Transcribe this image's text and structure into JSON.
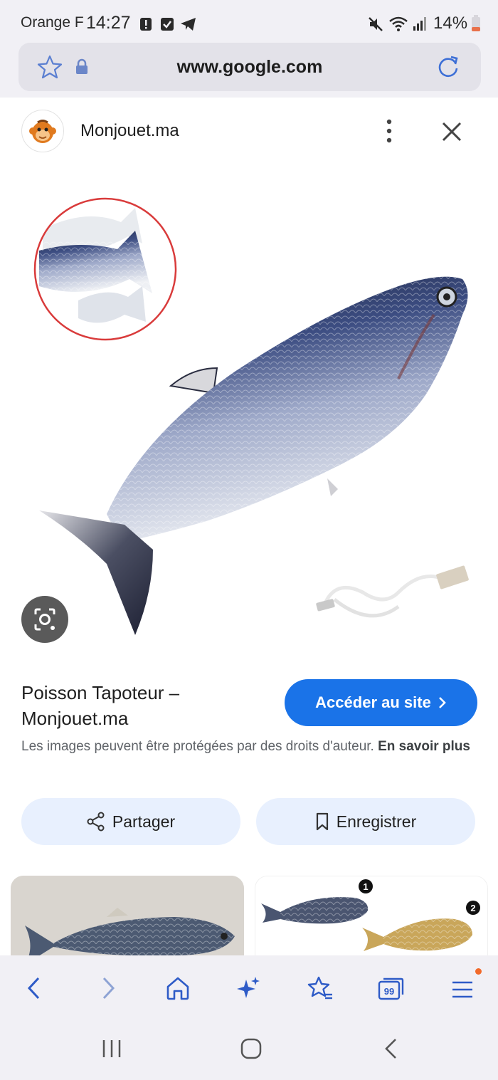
{
  "status_bar": {
    "carrier": "Orange F",
    "time": "14:27",
    "battery": "14%"
  },
  "browser": {
    "url": "www.google.com"
  },
  "card": {
    "site_name": "Monjouet.ma",
    "title": "Poisson Tapoteur – Monjouet.ma",
    "visit_label": "Accéder au site",
    "copyright_text": "Les images peuvent être protégées par des droits d'auteur.",
    "learn_more": "En savoir plus",
    "share_label": "Partager",
    "save_label": "Enregistrer"
  },
  "colors": {
    "accent": "#1a73e8",
    "pill_bg": "#e8f0fe",
    "bar_bg": "#f1f0f5"
  }
}
